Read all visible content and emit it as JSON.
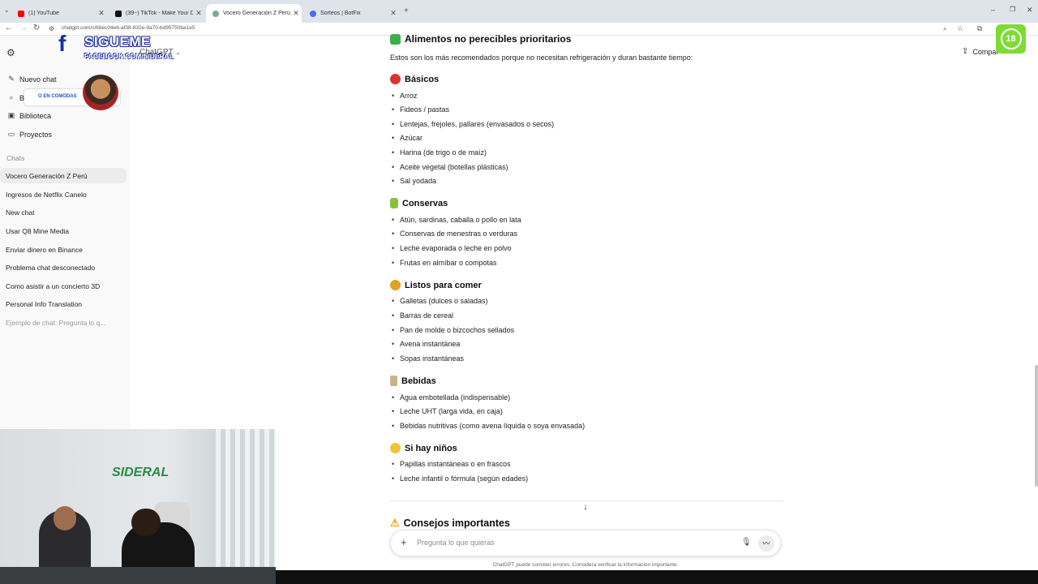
{
  "browser": {
    "tabs": [
      {
        "title": "(1) YouTube",
        "favicon_color": "#ff0000"
      },
      {
        "title": "(39~) TikTok - Make Your Day",
        "favicon_color": "#111111"
      },
      {
        "title": "Vocero Generación Z Perú",
        "favicon_color": "#74aa9c"
      },
      {
        "title": "Sorteos | BotFix",
        "favicon_color": "#4a6cf7"
      }
    ],
    "url": "chatgpt.com/c/68ec04e6-af38-832e-9a70-bd95750ba1e5",
    "new_tab_icon": "plus-icon"
  },
  "sidebar": {
    "nav": [
      {
        "label": "Nuevo chat",
        "icon": "edit-icon"
      },
      {
        "label": "Bu",
        "icon": "search-icon"
      },
      {
        "label": "Biblioteca",
        "icon": "library-icon"
      },
      {
        "label": "Proyectos",
        "icon": "folder-icon"
      }
    ],
    "section_label": "Chats",
    "chats": [
      "Vocero Generación Z Perú",
      "Ingresos de Netflix Canelo",
      "New chat",
      "Usar Q8 Mine Media",
      "Enviar dinero en Binance",
      "Problema chat desconectado",
      "Como asistir a un concierto 3D",
      "Personal Info Translation",
      "Ejemplo de chat: Pregunta lo q..."
    ]
  },
  "overlay": {
    "follow_title": "SIGUEME",
    "follow_handle": "FACEBOOK.COM/SIDERAL",
    "promo_text": "O EN COMODAS",
    "webcam_logo": "SIDERAL"
  },
  "header": {
    "model": "ChatGPT",
    "share_label": "Compar",
    "age_badge": "18"
  },
  "content": {
    "section_title": "Alimentos no perecibles prioritarios",
    "intro": "Estos son los más recomendados porque no necesitan refrigeración y duran bastante tiempo:",
    "groups": [
      {
        "title": "Básicos",
        "emoji_color": "#d8362e",
        "items": [
          "Arroz",
          "Fideos / pastas",
          "Lentejas, frejoles, pallares (envasados o secos)",
          "Azúcar",
          "Harina (de trigo o de maíz)",
          "Aceite vegetal (botellas plásticas)",
          "Sal yodada"
        ]
      },
      {
        "title": "Conservas",
        "emoji_color": "#8bbf3a",
        "items": [
          "Atún, sardinas, caballa o pollo en lata",
          "Conservas de menestras o verduras",
          "Leche evaporada o leche en polvo",
          "Frutas en almíbar o compotas"
        ]
      },
      {
        "title": "Listos para comer",
        "emoji_color": "#e0a127",
        "items": [
          "Galletas (dulces o saladas)",
          "Barras de cereal",
          "Pan de molde o bizcochos sellados",
          "Avena instantánea",
          "Sopas instantáneas"
        ]
      },
      {
        "title": "Bebidas",
        "emoji_color": "#c9b48a",
        "items": [
          "Agua embotellada (indispensable)",
          "Leche UHT (larga vida, en caja)",
          "Bebidas nutritivas (como avena líquida o soya envasada)"
        ]
      },
      {
        "title": "Si hay niños",
        "emoji_color": "#f2c33a",
        "items": [
          "Papillas instantáneas o en frascos",
          "Leche infantil o fórmula (según edades)"
        ]
      }
    ],
    "next_title": "Consejos importantes"
  },
  "composer": {
    "placeholder": "Pregunta lo que quieras",
    "disclaimer": "ChatGPT puede cometer errores. Considera verificar la información importante."
  }
}
